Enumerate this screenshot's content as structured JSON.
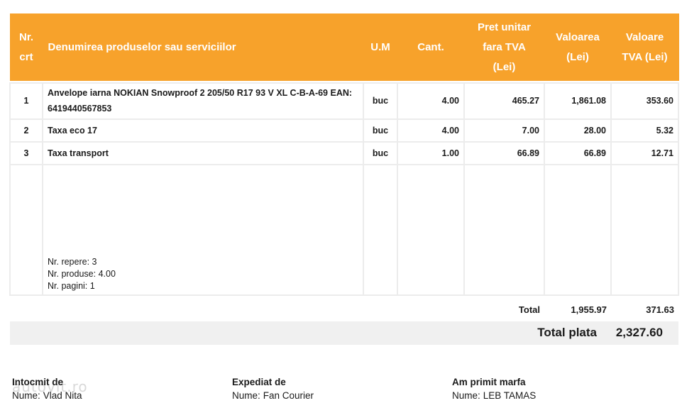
{
  "table": {
    "headers": {
      "nr": [
        "Nr.",
        "crt"
      ],
      "name": "Denumirea produselor sau serviciilor",
      "um": "U.M",
      "qty": "Cant.",
      "unit_price": [
        "Pret unitar",
        "fara TVA",
        "(Lei)"
      ],
      "value": [
        "Valoarea",
        "(Lei)"
      ],
      "vat": [
        "Valoare",
        "TVA (Lei)"
      ]
    },
    "rows": [
      {
        "nr": "1",
        "name_line1": "Anvelope iarna NOKIAN Snowproof 2 205/50 R17 93 V XL C-B-A-69 EAN:",
        "name_line2": "6419440567853",
        "um": "buc",
        "qty": "4.00",
        "unit_price": "465.27",
        "value": "1,861.08",
        "vat": "353.60"
      },
      {
        "nr": "2",
        "name_line1": "Taxa eco 17",
        "um": "buc",
        "qty": "4.00",
        "unit_price": "7.00",
        "value": "28.00",
        "vat": "5.32"
      },
      {
        "nr": "3",
        "name_line1": "Taxa transport",
        "um": "buc",
        "qty": "1.00",
        "unit_price": "66.89",
        "value": "66.89",
        "vat": "12.71"
      }
    ],
    "notes": {
      "repere": "Nr. repere: 3",
      "produse": "Nr. produse: 4.00",
      "pagini": "Nr. pagini: 1"
    },
    "total": {
      "label": "Total",
      "value": "1,955.97",
      "vat": "371.63"
    },
    "grand_total": {
      "label": "Total plata",
      "value": "2,327.60"
    }
  },
  "footer": {
    "issued": {
      "heading": "Intocmit de",
      "name_label": "Nume:",
      "name": "Vlad Nita"
    },
    "shipped": {
      "heading": "Expediat de",
      "name_label": "Nume:",
      "name": "Fan Courier"
    },
    "received": {
      "heading": "Am primit marfa",
      "name_label": "Nume:",
      "name": "LEB TAMAS"
    },
    "watermark": "autovit.ro"
  },
  "colors": {
    "header_bg": "#f7a22b",
    "header_text": "#ffffff",
    "grid": "#ececec",
    "grand_total_bg": "#f0f0f0"
  }
}
